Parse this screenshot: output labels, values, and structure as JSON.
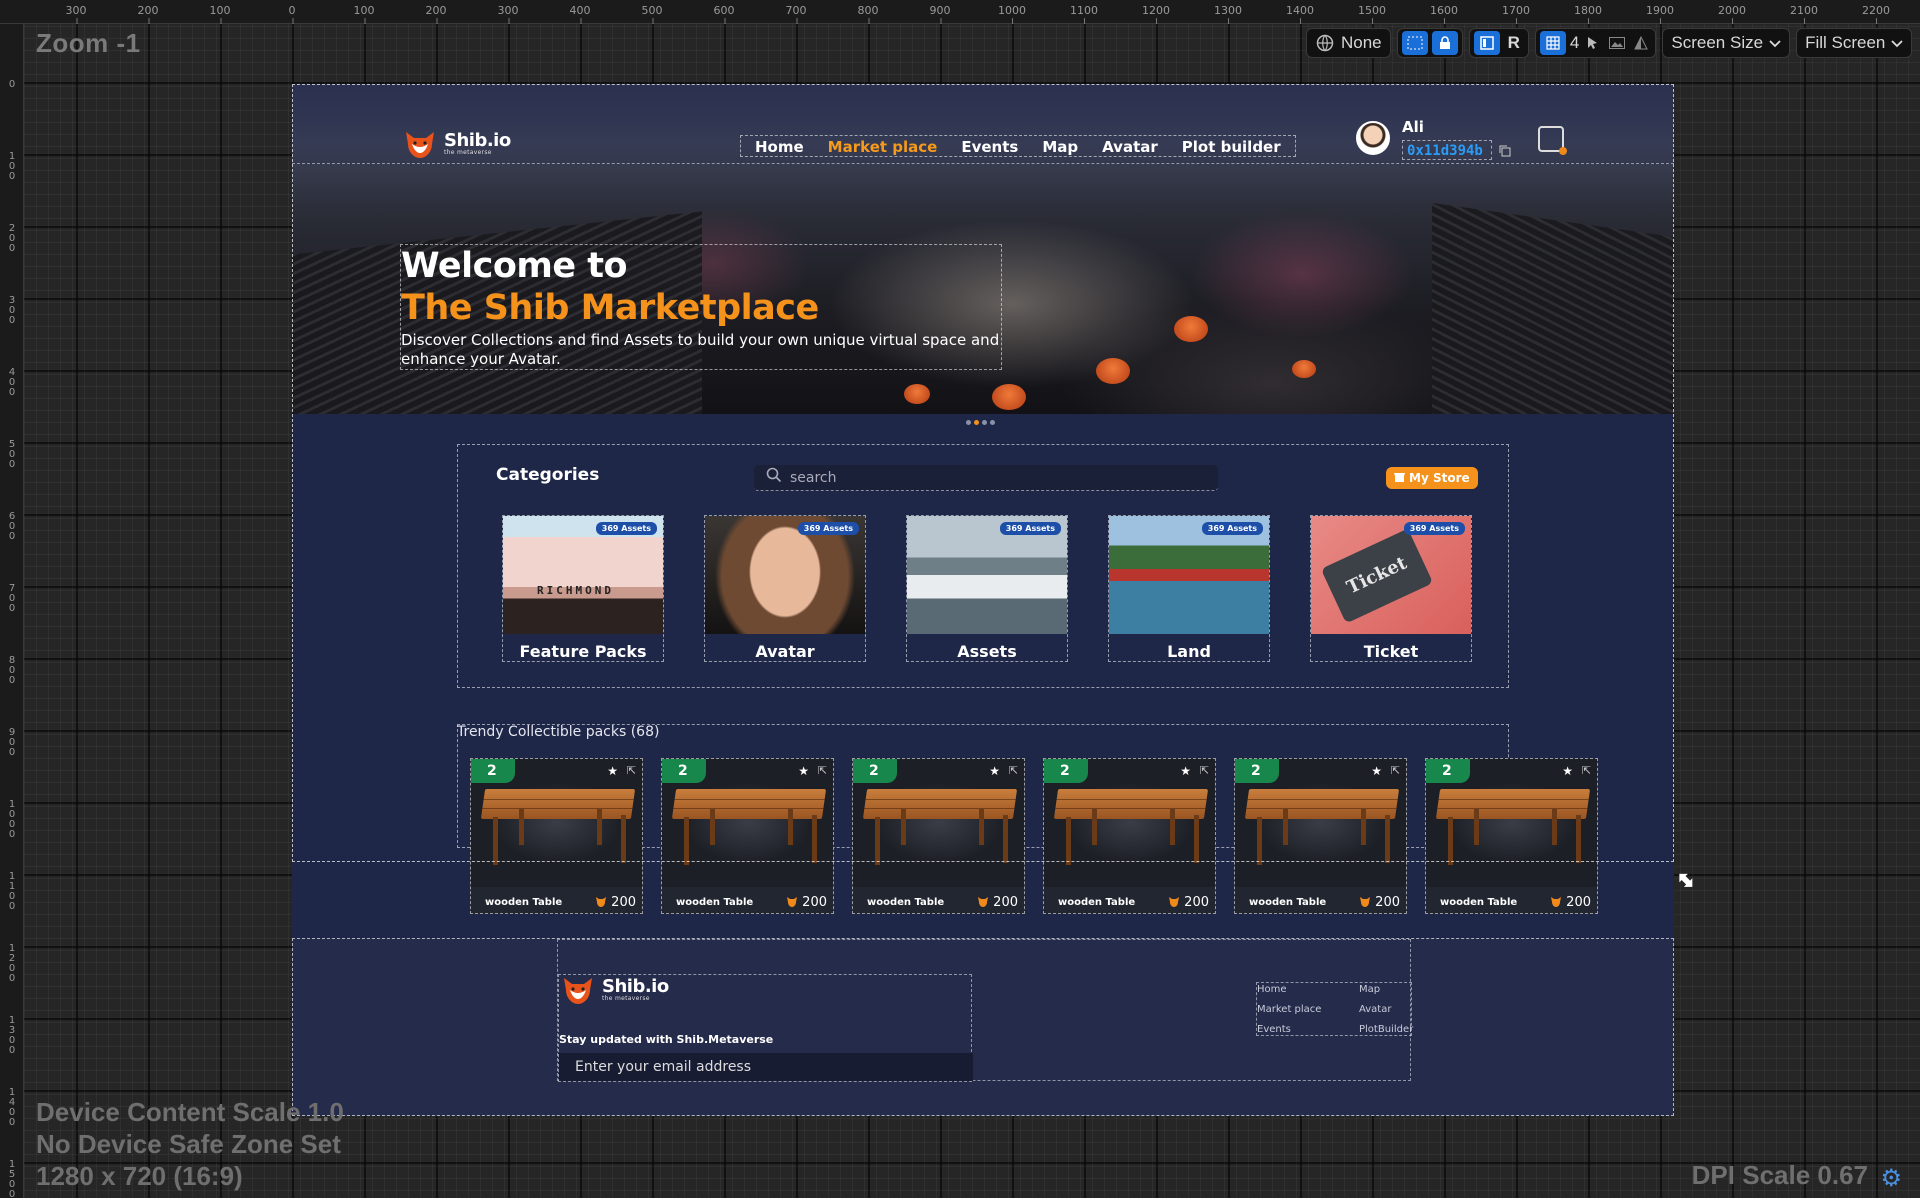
{
  "designer": {
    "zoom_label": "Zoom -1",
    "ruler_top_ticks": [
      "300",
      "200",
      "100",
      "0",
      "100",
      "200",
      "300",
      "400",
      "500",
      "600",
      "700",
      "800",
      "900",
      "1000",
      "1100",
      "1200",
      "1300",
      "1400",
      "1500",
      "1600",
      "1700",
      "1800",
      "1900",
      "2000",
      "2100",
      "2200"
    ],
    "ruler_left_ticks": [
      "0",
      "100",
      "200",
      "300",
      "400",
      "500",
      "600",
      "700",
      "800",
      "900",
      "1000",
      "1100",
      "1200",
      "1300",
      "1400",
      "1500"
    ],
    "toolbar": {
      "locale": "None",
      "r_label": "R",
      "grid_count": "4",
      "screen_size": "Screen Size",
      "fill_screen": "Fill Screen"
    },
    "info_lines": [
      "Device Content Scale 1.0",
      "No Device Safe Zone Set",
      "1280 x 720 (16:9)"
    ],
    "dpi_label": "DPI Scale 0.67",
    "icons": [
      "globe-icon",
      "selection-icon",
      "lock-icon",
      "layout-icon",
      "grid-icon",
      "cursor-icon",
      "image-icon",
      "contrast-icon",
      "chevron-down-icon",
      "settings-icon",
      "resize-icon"
    ]
  },
  "header": {
    "logo_text": "Shib.io",
    "logo_sub": "the metaverse",
    "nav": [
      {
        "label": "Home",
        "active": false
      },
      {
        "label": "Market place",
        "active": true
      },
      {
        "label": "Events",
        "active": false
      },
      {
        "label": "Map",
        "active": false
      },
      {
        "label": "Avatar",
        "active": false
      },
      {
        "label": "Plot builder",
        "active": false
      }
    ],
    "user_name": "Ali",
    "wallet_address": "0x11d394b"
  },
  "hero": {
    "line1": "Welcome to",
    "line2": "The Shib Marketplace",
    "description": "Discover Collections and find Assets to build your own unique virtual space and enhance your Avatar."
  },
  "categories": {
    "title": "Categories",
    "search_placeholder": "search",
    "my_store_label": "My Store",
    "items": [
      {
        "name": "Feature Packs",
        "badge": "369 Assets"
      },
      {
        "name": "Avatar",
        "badge": "369 Assets"
      },
      {
        "name": "Assets",
        "badge": "369 Assets"
      },
      {
        "name": "Land",
        "badge": "369 Assets"
      },
      {
        "name": "Ticket",
        "badge": "369 Assets"
      }
    ]
  },
  "trendy": {
    "title": "Trendy Collectible packs (68)",
    "items": [
      {
        "badge": "2",
        "name": "wooden Table",
        "price": "200"
      },
      {
        "badge": "2",
        "name": "wooden Table",
        "price": "200"
      },
      {
        "badge": "2",
        "name": "wooden Table",
        "price": "200"
      },
      {
        "badge": "2",
        "name": "wooden Table",
        "price": "200"
      },
      {
        "badge": "2",
        "name": "wooden Table",
        "price": "200"
      },
      {
        "badge": "2",
        "name": "wooden Table",
        "price": "200"
      }
    ]
  },
  "footer": {
    "logo_text": "Shib.io",
    "logo_sub": "the metaverse",
    "tagline": "Stay updated with Shib.Metaverse",
    "email_placeholder": "Enter your email address",
    "links_col1": [
      "Home",
      "Market place",
      "Events"
    ],
    "links_col2": [
      "Map",
      "Avatar",
      "PlotBuilder"
    ]
  },
  "colors": {
    "accent_orange": "#f5921b",
    "badge_green": "#17874b",
    "badge_blue": "#1d4fa8",
    "page_bg": "#1f2748",
    "address_blue": "#2b9cf5"
  }
}
